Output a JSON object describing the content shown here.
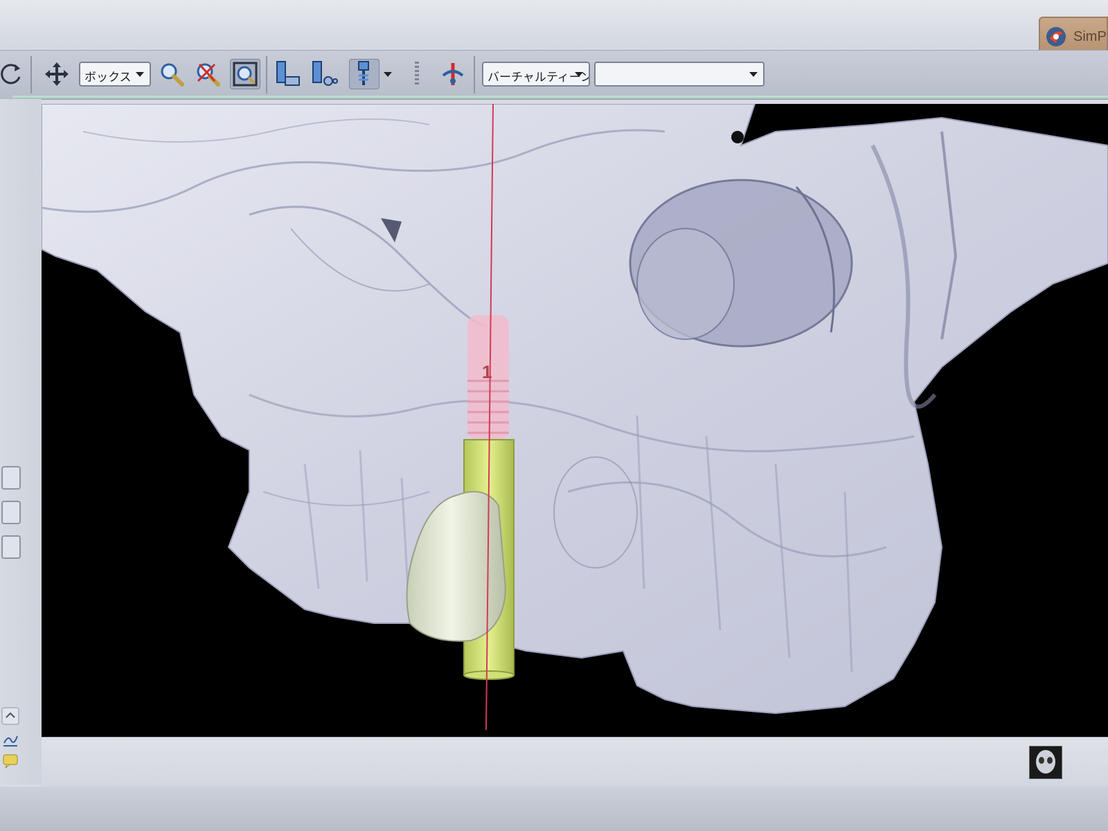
{
  "app": {
    "brand_text": "SimP",
    "brand_icon": "simplant-logo-icon"
  },
  "toolbar": {
    "buttons": [
      {
        "name": "rotate-icon"
      },
      {
        "name": "pan-icon"
      },
      {
        "name": "zoom-icon"
      },
      {
        "name": "zoom-reset-icon"
      },
      {
        "name": "zoom-fit-icon"
      },
      {
        "name": "implant-tool-1-icon"
      },
      {
        "name": "implant-tool-2-icon"
      },
      {
        "name": "implant-tool-3-icon"
      },
      {
        "name": "axis-tool-icon"
      },
      {
        "name": "nerve-tool-icon"
      }
    ],
    "mode_select": {
      "value": "ボックス"
    },
    "virtual_teeth_select": {
      "value": "バーチャルティーン"
    },
    "empty_select": {
      "value": ""
    }
  },
  "viewport": {
    "implant_label": "1",
    "colors": {
      "bone": "#d6d8e6",
      "bone_shadow": "#8e93ad",
      "implant_thread": "#f2bccb",
      "abutment": "#cfe07a",
      "crown": "#e6ecd8",
      "axis_line": "#d23a56",
      "background": "#000000"
    }
  }
}
